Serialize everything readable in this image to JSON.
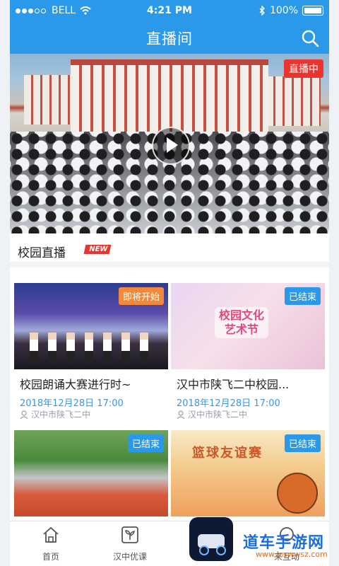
{
  "status_bar": {
    "carrier": "BELL",
    "time": "4:21 PM",
    "battery": "100%"
  },
  "nav": {
    "title": "直播间"
  },
  "hero": {
    "live_label": "直播中"
  },
  "section": {
    "title": "校园直播",
    "new_badge": "NEW"
  },
  "cards": [
    {
      "badge": "即将开始",
      "badge_color": "#f08a3a",
      "title": "校园朗诵大赛进行时~",
      "date": "2018年12月28日 17:00",
      "location": "汉中市陕飞二中"
    },
    {
      "badge": "已结束",
      "badge_color": "#2b99ea",
      "title": "汉中市陕飞二中校园...",
      "date": "2018年12月28日 17:00",
      "location": "汉中市陕飞二中",
      "image_text": "校园文化\n艺术节"
    },
    {
      "badge": "已结束",
      "badge_color": "#2b99ea"
    },
    {
      "badge": "已结束",
      "badge_color": "#2b99ea",
      "image_text": "篮球友谊赛"
    }
  ],
  "tabbar": {
    "items": [
      {
        "label": "首页"
      },
      {
        "label": "汉中优课"
      },
      {
        "label": "来互动"
      }
    ]
  },
  "watermark": {
    "text": "道车手游网",
    "sub": "www.lnswwsz.com"
  },
  "colors": {
    "primary": "#2b99ea",
    "live": "#e9352e",
    "upcoming": "#f08a3a"
  }
}
